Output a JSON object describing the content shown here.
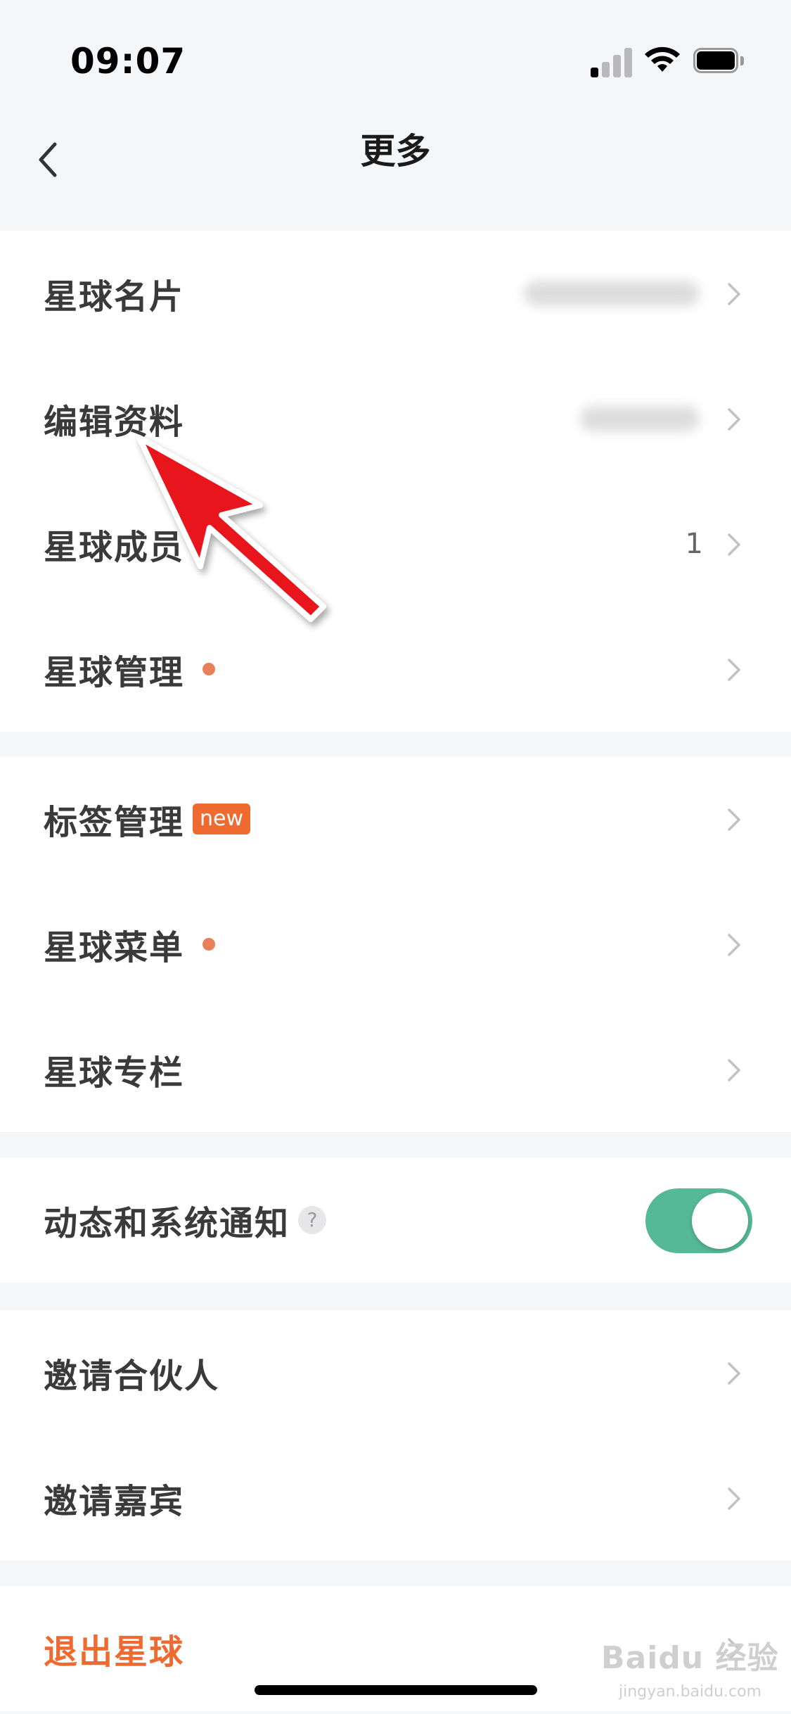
{
  "status_bar": {
    "time": "09:07"
  },
  "nav": {
    "title": "更多"
  },
  "groups": [
    {
      "items": [
        {
          "label": "星球名片",
          "value": "",
          "blurred": true
        },
        {
          "label": "编辑资料",
          "value": "",
          "blurred": true
        },
        {
          "label": "星球成员",
          "value": "1"
        },
        {
          "label": "星球管理",
          "dot": true
        }
      ]
    },
    {
      "items": [
        {
          "label": "标签管理",
          "badge": "new"
        },
        {
          "label": "星球菜单",
          "dot": true
        },
        {
          "label": "星球专栏"
        }
      ]
    },
    {
      "items": [
        {
          "label": "动态和系统通知",
          "help": "?",
          "toggle": true
        }
      ]
    },
    {
      "items": [
        {
          "label": "邀请合伙人"
        },
        {
          "label": "邀请嘉宾"
        }
      ]
    },
    {
      "items": [
        {
          "label": "退出星球",
          "danger": true
        }
      ]
    }
  ],
  "colors": {
    "accent": "#ef6a31",
    "toggle_on": "#55b896",
    "dot": "#e8805a"
  },
  "watermark": {
    "text": "Baidu 经验",
    "sub": "jingyan.baidu.com"
  }
}
